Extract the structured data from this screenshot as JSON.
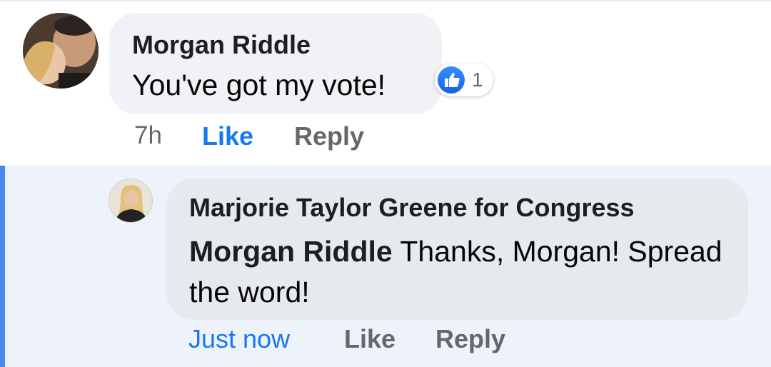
{
  "comment": {
    "author": "Morgan Riddle",
    "text": "You've got my vote!",
    "reaction": {
      "icon": "like-reaction-icon",
      "count": "1"
    },
    "actions": {
      "time": "7h",
      "like": "Like",
      "reply": "Reply"
    }
  },
  "reply": {
    "author": "Marjorie Taylor Greene for Congress",
    "mention": "Morgan Riddle",
    "text": " Thanks, Morgan! Spread the word!",
    "actions": {
      "time": "Just now",
      "like": "Like",
      "reply": "Reply"
    }
  },
  "colors": {
    "accent": "#1877f2",
    "bubble": "#f0f2f5",
    "reply_bg": "#eef3fb",
    "thread_bar": "#4a86f0",
    "muted": "#65676b"
  }
}
